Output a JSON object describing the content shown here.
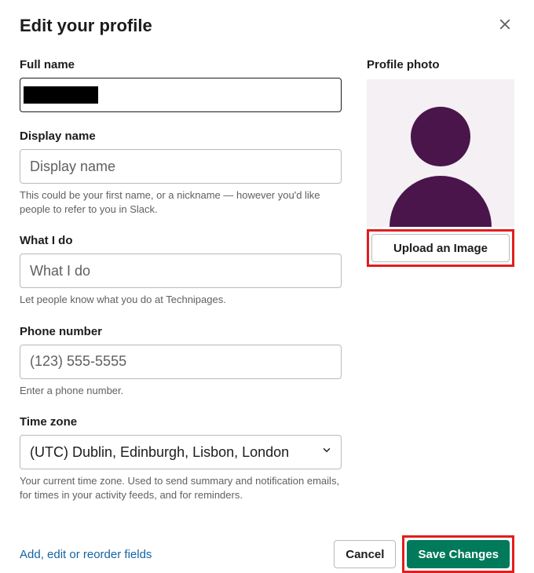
{
  "header": {
    "title": "Edit your profile"
  },
  "fields": {
    "full_name": {
      "label": "Full name",
      "value": ""
    },
    "display_name": {
      "label": "Display name",
      "placeholder": "Display name",
      "help": "This could be your first name, or a nickname — however you'd like people to refer to you in Slack."
    },
    "what_i_do": {
      "label": "What I do",
      "placeholder": "What I do",
      "help": "Let people know what you do at Technipages."
    },
    "phone": {
      "label": "Phone number",
      "placeholder": "(123) 555-5555",
      "help": "Enter a phone number."
    },
    "timezone": {
      "label": "Time zone",
      "value": "(UTC) Dublin, Edinburgh, Lisbon, London",
      "help": "Your current time zone. Used to send summary and notification emails, for times in your activity feeds, and for reminders."
    }
  },
  "photo": {
    "label": "Profile photo",
    "upload_label": "Upload an Image"
  },
  "footer": {
    "link": "Add, edit or reorder fields",
    "cancel": "Cancel",
    "save": "Save Changes"
  }
}
